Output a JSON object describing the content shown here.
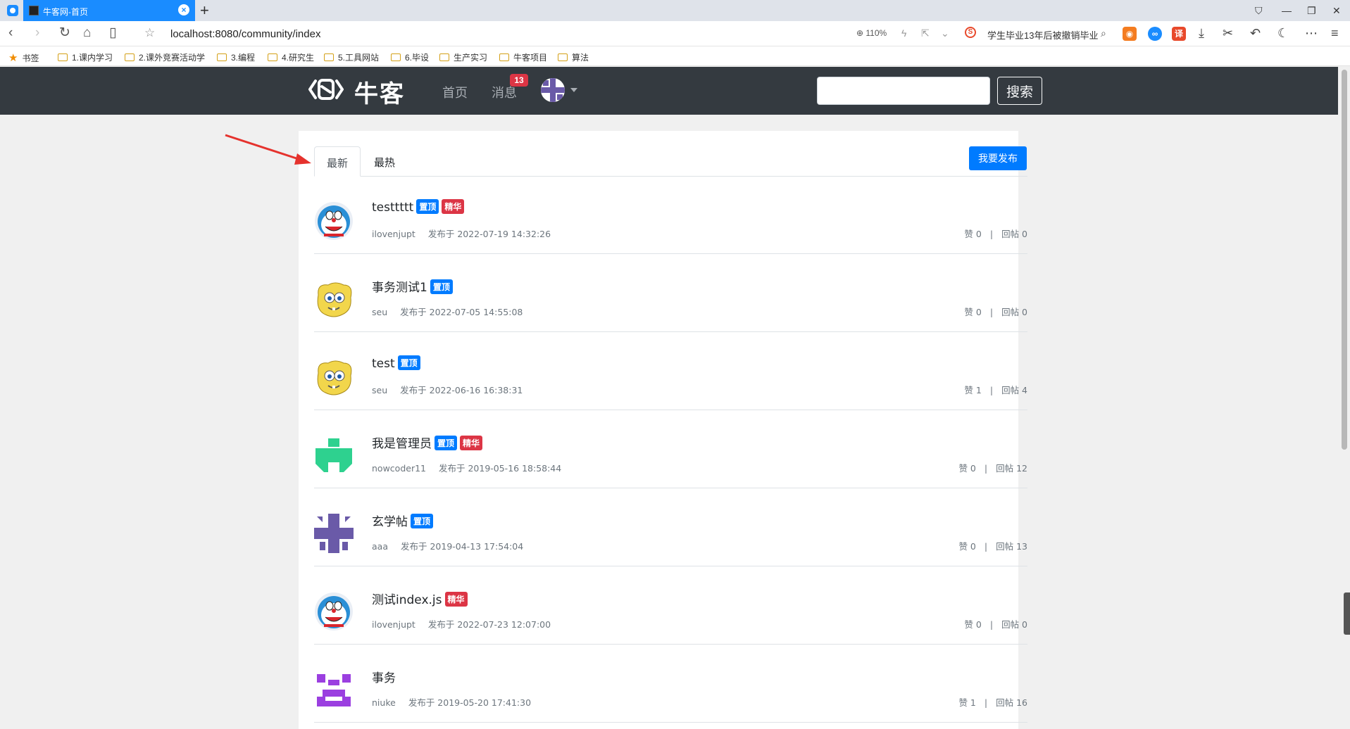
{
  "browser": {
    "tab_title": "牛客网-首页",
    "url": "localhost:8080/community/index",
    "zoom": "110%",
    "news_ticker": "学生毕业13年后被撤销毕业",
    "bookmarks": [
      {
        "label": "书签",
        "type": "star"
      },
      {
        "label": "1.课内学习",
        "type": "folder"
      },
      {
        "label": "2.课外竞赛活动学",
        "type": "folder"
      },
      {
        "label": "3.编程",
        "type": "folder"
      },
      {
        "label": "4.研究生",
        "type": "folder"
      },
      {
        "label": "5.工具网站",
        "type": "folder"
      },
      {
        "label": "6.毕设",
        "type": "folder"
      },
      {
        "label": "生产实习",
        "type": "folder"
      },
      {
        "label": "牛客项目",
        "type": "folder"
      },
      {
        "label": "算法",
        "type": "folder"
      }
    ],
    "ext_translate": "译"
  },
  "header": {
    "logo_text": "牛客",
    "nav_home": "首页",
    "nav_messages": "消息",
    "message_count": "13",
    "search_placeholder": "",
    "search_button": "搜索"
  },
  "main": {
    "tabs": [
      {
        "label": "最新",
        "active": true
      },
      {
        "label": "最热",
        "active": false
      }
    ],
    "publish_button": "我要发布",
    "posts": [
      {
        "title": "testtttt",
        "top": "置顶",
        "essence": "精华",
        "author": "ilovenjupt",
        "posted": "发布于 2022-07-19 14:32:26",
        "likes": "赞 0",
        "replies": "回帖 0",
        "avatar": "doraemon-icon"
      },
      {
        "title": "事务测试1",
        "top": "置顶",
        "essence": "",
        "author": "seu",
        "posted": "发布于 2022-07-05 14:55:08",
        "likes": "赞 0",
        "replies": "回帖 0",
        "avatar": "yellow-monster-icon"
      },
      {
        "title": "test",
        "top": "置顶",
        "essence": "",
        "author": "seu",
        "posted": "发布于 2022-06-16 16:38:31",
        "likes": "赞 1",
        "replies": "回帖 4",
        "avatar": "yellow-monster-icon"
      },
      {
        "title": "我是管理员",
        "top": "置顶",
        "essence": "精华",
        "author": "nowcoder11",
        "posted": "发布于 2019-05-16 18:58:44",
        "likes": "赞 0",
        "replies": "回帖 12",
        "avatar": "green-identicon"
      },
      {
        "title": "玄学帖",
        "top": "置顶",
        "essence": "",
        "author": "aaa",
        "posted": "发布于 2019-04-13 17:54:04",
        "likes": "赞 0",
        "replies": "回帖 13",
        "avatar": "purple-identicon"
      },
      {
        "title": "测试index.js",
        "top": "",
        "essence": "精华",
        "author": "ilovenjupt",
        "posted": "发布于 2022-07-23 12:07:00",
        "likes": "赞 0",
        "replies": "回帖 0",
        "avatar": "doraemon-icon"
      },
      {
        "title": "事务",
        "top": "",
        "essence": "",
        "author": "niuke",
        "posted": "发布于 2019-05-20 17:41:30",
        "likes": "赞 1",
        "replies": "回帖 16",
        "avatar": "violet-identicon"
      }
    ]
  },
  "colors": {
    "header_bg": "#343a40",
    "primary": "#007bff",
    "danger": "#dc3545",
    "muted": "#6c757d",
    "annotation_arrow": "#e5322d"
  }
}
